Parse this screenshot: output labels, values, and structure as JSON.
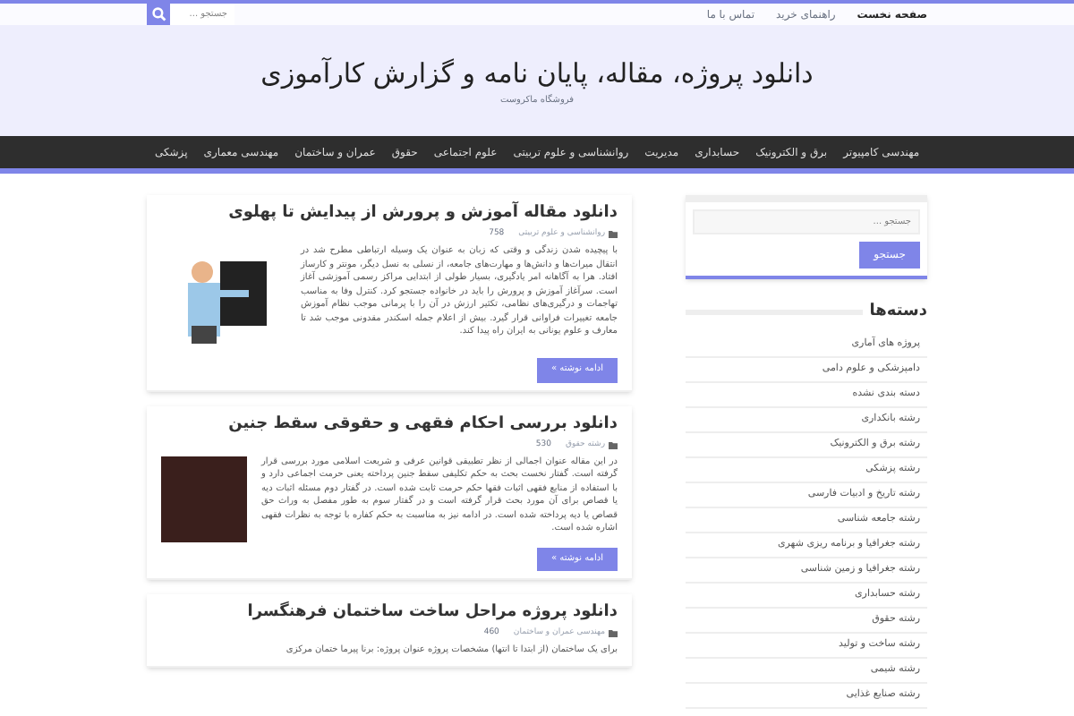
{
  "top_bar": {
    "links": [
      {
        "label": "صفحه نخست",
        "selected": true
      },
      {
        "label": "راهنمای خرید",
        "selected": false
      },
      {
        "label": "تماس با ما",
        "selected": false
      }
    ],
    "search": {
      "placeholder": "جستجو ..."
    }
  },
  "header": {
    "title": "دانلود پروژه، مقاله، پایان نامه و گزارش کارآموزی",
    "subtitle": "فروشگاه ماکروست"
  },
  "nav": [
    "مهندسی کامپیوتر",
    "برق و الکترونیک",
    "حسابداری",
    "مدیریت",
    "روانشناسی و علوم تربیتی",
    "علوم اجتماعی",
    "حقوق",
    "عمران و ساختمان",
    "مهندسی معماری",
    "پزشکی"
  ],
  "posts": [
    {
      "title": "دانلود مقاله آموزش و پرورش از پیدایش تا پهلوی",
      "category": "روانشناسی و علوم تربیتی",
      "views": "758",
      "excerpt": "با پیچیده شدن زندگی و وقتی که زبان به عنوان یک وسیله ارتباطی مطرح شد در انتقال میراث‌ها و دانش‌ها و مهارت‌های جامعه، از نسلی به نسل دیگر، مونتر و کارساز افتاد. هرا به آگاهانه امر یادگیری، بسیار طولی از ابتدایی مراکز رسمی آموزشی آغاز است. سرآغاز آموزش و پرورش را باید در خانواده جستجو کرد. کنترل وفا به مناسب تهاجمات و درگیری‌های نظامی، تکثیر ارزش در آن را با پرمانی موجب نظام آموزش جامعه تغییرات فراوانی قرار گیرد. بیش از اعلام جمله اسکندر مقدونی موجب شد تا معارف و علوم یونانی به ایران راه پیدا کند.",
      "kind": "illustration",
      "more": "ادامه نوشته »"
    },
    {
      "title": "دانلود بررسی احکام فقهی و حقوقی سقط جنین",
      "category": "رشته حقوق",
      "views": "530",
      "excerpt": "در این مقاله عنوان اجمالی از نظر تطبیقی قوانین عرفی و شریعت اسلامی مورد بررسی قرار گرفته است. گفتار نخست بحث به حکم تکلیفی سقط جنین پرداخته یعنی حرمت اجماعی دارد و با استفاده از منابع فقهی اثبات فقها حکم حرمت ثابت شده است. در گفتار دوم مسئله اثبات دیه یا قصاص برای آن مورد بحث قرار گرفته است و در گفتار سوم به طور مفصل به وراث حق قصاص یا دیه پرداخته شده است. در ادامه نیز به مناسبت به حکم کفاره با توجه به نظرات فقهی اشاره شده است.",
      "kind": "photo",
      "more": "ادامه نوشته »"
    },
    {
      "title": "دانلود پروژه مراحل ساخت ساختمان فرهنگسرا",
      "category": "مهندسی عمران و ساختمان",
      "views": "460",
      "excerpt": "برای یک ساختمان (از ابتدا تا انتها) مشخصات پروژه عنوان پروژه: برنا پیرما ختمان مرکزی"
    }
  ],
  "sidebar": {
    "search": {
      "placeholder": "جستجو ...",
      "button": "جستجو"
    },
    "categories_title": "دسته‌ها",
    "categories": [
      "پروژه های آماری",
      "دامپزشکی و علوم دامی",
      "دسته بندی نشده",
      "رشته بانکداری",
      "رشته برق و الکترونیک",
      "رشته پزشکی",
      "رشته تاریخ و ادبیات فارسی",
      "رشته جامعه شناسی",
      "رشته جغرافیا و برنامه ریزی شهری",
      "رشته جغرافیا و زمین شناسی",
      "رشته حسابداری",
      "رشته حقوق",
      "رشته ساخت و تولید",
      "رشته شیمی",
      "رشته صنایع غذایی"
    ]
  }
}
